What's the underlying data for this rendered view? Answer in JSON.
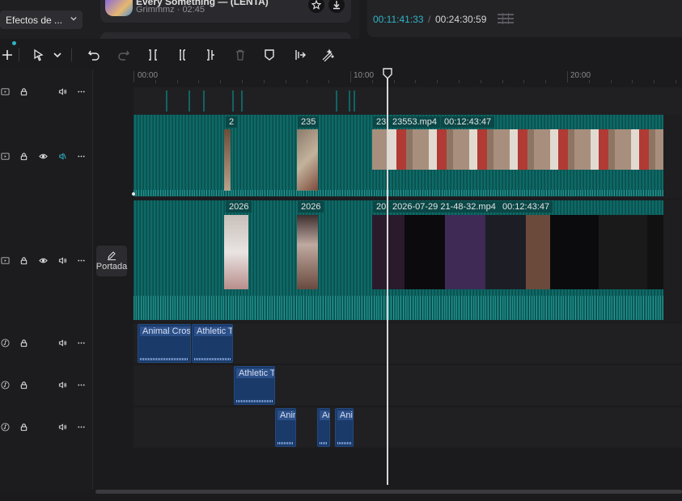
{
  "effects_select": {
    "label": "Efectos de ..."
  },
  "music": {
    "title": "Every Something — (LENTA)",
    "artist": "Grimmmz",
    "duration": "02:45"
  },
  "player": {
    "current_time": "00:11:41:33",
    "separator": "/",
    "total_time": "00:24:30:59"
  },
  "ruler": {
    "ticks": [
      "00:00",
      "10:00",
      "20:00"
    ]
  },
  "cover": {
    "label": "Portada"
  },
  "video_clips": [
    {
      "label": "2",
      "duration": ""
    },
    {
      "label": "235",
      "duration": ""
    },
    {
      "label": "23",
      "duration": ""
    },
    {
      "label": "23553.mp4",
      "duration": "00:12:43:47"
    }
  ],
  "main_clips": [
    {
      "label": "2026",
      "duration": ""
    },
    {
      "label": "2026",
      "duration": ""
    },
    {
      "label": "20",
      "duration": ""
    },
    {
      "label": "2026-07-29 21-48-32.mp4",
      "duration": "00:12:43:47"
    }
  ],
  "audio_clips": [
    {
      "label": "Animal Crossi"
    },
    {
      "label": "Athletic Th"
    },
    {
      "label": "Athletic Th"
    },
    {
      "label": "Anim"
    },
    {
      "label": "Ani"
    },
    {
      "label": "Anim"
    }
  ],
  "icons": {
    "toolbar": [
      "add-icon",
      "select-cursor-icon",
      "chevron-down-icon",
      "undo-icon",
      "redo-icon",
      "split-icon",
      "split-left-icon",
      "split-right-icon",
      "delete-icon",
      "marker-icon",
      "extract-audio-icon",
      "auto-edit-icon"
    ],
    "track_header": [
      "visibility-icon",
      "lock-icon",
      "eye-icon",
      "volume-icon",
      "more-icon",
      "music-note-icon"
    ]
  },
  "colors": {
    "accent": "#2fb4c4",
    "video_clip": "#0c5c5a",
    "audio_clip": "#1a3a6a",
    "playhead": "#d8d8d8"
  }
}
